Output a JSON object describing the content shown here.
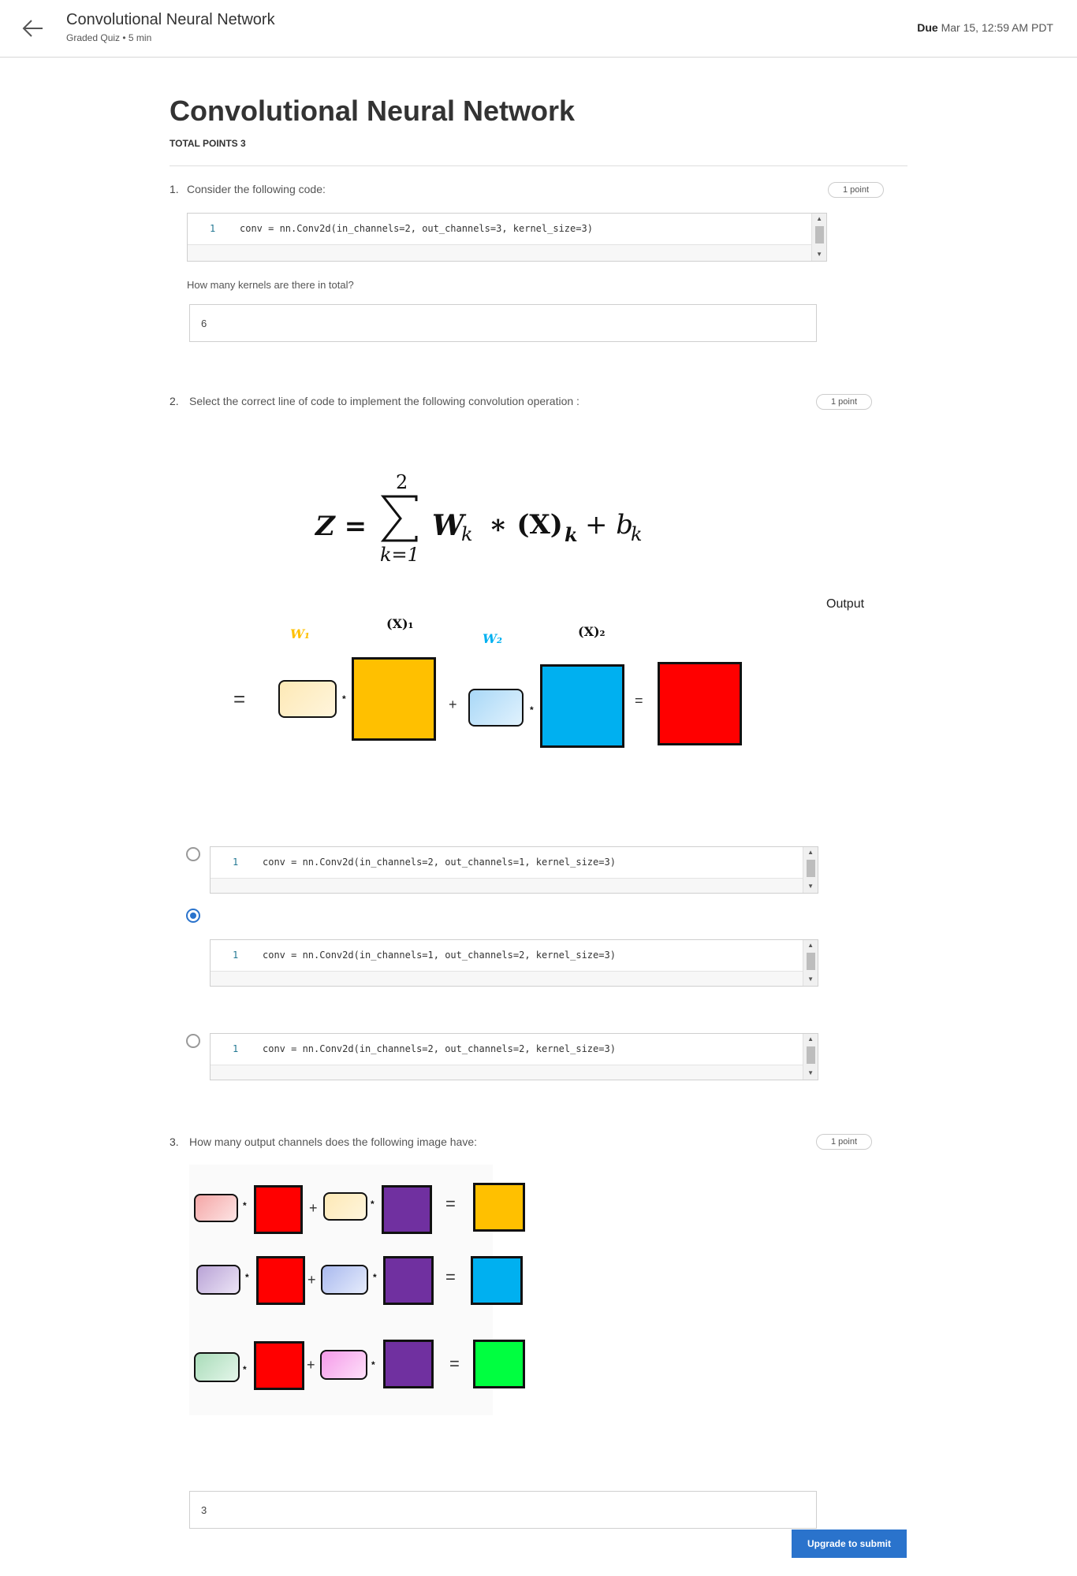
{
  "header": {
    "title": "Convolutional Neural Network",
    "subtitle": "Graded Quiz • 5 min",
    "due_label": "Due",
    "due_value": "Mar 15, 12:59 AM PDT"
  },
  "main": {
    "title": "Convolutional Neural Network",
    "total_points": "TOTAL POINTS 3"
  },
  "q1": {
    "number": "1.",
    "text": "Consider the following code:",
    "points": "1 point",
    "code_line_no": "1",
    "code": "conv = nn.Conv2d(in_channels=2, out_channels=3, kernel_size=3)",
    "prompt": "How many kernels are there in total?",
    "answer": "6"
  },
  "q2": {
    "number": "2.",
    "text": "Select the correct line of code to implement the following convolution operation :",
    "points": "1 point",
    "formula": {
      "lhs": "Z =",
      "sum_top": "2",
      "sum_bottom": "k=1",
      "body": "W",
      "body_sub": "k",
      "op": "∗ (X)",
      "x_sub": "k",
      "plus": "+ b",
      "b_sub": "k"
    },
    "figure": {
      "w1": "W₁",
      "x1": "(X)₁",
      "w2": "W₂",
      "x2": "(X)₂",
      "output": "Output",
      "equals": "=",
      "star": "*",
      "plus": "+"
    },
    "options": [
      {
        "line_no": "1",
        "code": "conv = nn.Conv2d(in_channels=2, out_channels=1, kernel_size=3)",
        "selected": false
      },
      {
        "line_no": "1",
        "code": "conv = nn.Conv2d(in_channels=1, out_channels=2, kernel_size=3)",
        "selected": true
      },
      {
        "line_no": "1",
        "code": "conv = nn.Conv2d(in_channels=2, out_channels=2, kernel_size=3)",
        "selected": false
      }
    ]
  },
  "q3": {
    "number": "3.",
    "text": "How many  output channels does the following image have:",
    "points": "1 point",
    "answer": "3",
    "symbols": {
      "star": "*",
      "plus": "+",
      "equals": "="
    }
  },
  "submit_label": "Upgrade to submit",
  "colors": {
    "accent": "#2a73cc",
    "yellow": "#ffc000",
    "blue": "#00b0f0",
    "red": "#ff0000",
    "purple": "#7030a0",
    "green": "#00ff40"
  }
}
